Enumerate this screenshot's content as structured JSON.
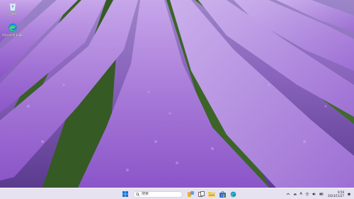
{
  "desktop": {
    "icons": [
      {
        "name": "回收站",
        "icon": "recycle-bin-icon"
      },
      {
        "name": "Microsoft Edge",
        "icon": "edge-icon"
      }
    ]
  },
  "taskbar": {
    "search_placeholder": "搜索",
    "pinned": [
      "start-icon",
      "search-icon",
      "widgets-icon",
      "task-view-icon",
      "file-explorer-icon",
      "microsoft-store-icon",
      "edge-icon"
    ],
    "tray": {
      "time": "9:59",
      "date": "2023/11/27",
      "input_method": "A",
      "icons": [
        "chevron-up-icon",
        "cloud-icon",
        "network-icon",
        "speaker-icon",
        "battery-icon",
        "notification-icon"
      ]
    }
  },
  "colors": {
    "lavender_light": "#b58ae0",
    "lavender_dark": "#6a3f9f",
    "grass": "#3f6a2a",
    "sky": "#8a7fb8",
    "taskbar": "#ece8f2",
    "windows_blue": "#0a74d4"
  }
}
